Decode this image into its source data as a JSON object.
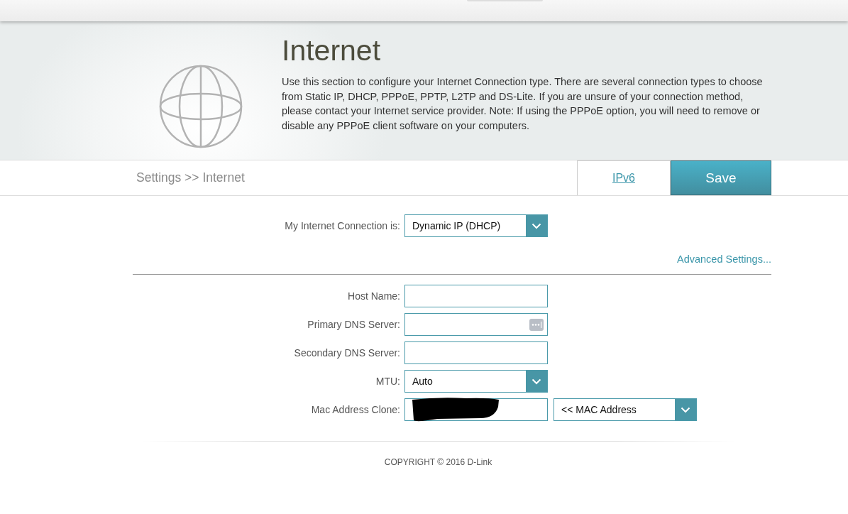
{
  "header": {
    "title": "Internet",
    "description": "Use this section to configure your Internet Connection type. There are several connection types to choose from Static IP, DHCP, PPPoE, PPTP, L2TP and DS-Lite. If you are unsure of your connection method, please contact your Internet service provider. Note: If using the PPPoE option, you will need to remove or disable any PPPoE client software on your computers."
  },
  "breadcrumb": "Settings >> Internet",
  "actions": {
    "link": "IPv6",
    "save": "Save"
  },
  "connection": {
    "label": "My Internet Connection is:",
    "value": "Dynamic IP (DHCP)"
  },
  "advanced_link": "Advanced Settings...",
  "fields": [
    {
      "kind": "text",
      "label": "Host Name:"
    },
    {
      "kind": "text",
      "label": "Primary DNS Server:",
      "autofill_icon": true
    },
    {
      "kind": "text",
      "label": "Secondary DNS Server:"
    },
    {
      "kind": "select",
      "label": "MTU:",
      "value": "Auto"
    },
    {
      "kind": "text",
      "label": "Mac Address Clone:",
      "redacted": true,
      "extra_select": "<< MAC Address"
    }
  ],
  "copyright": "COPYRIGHT © 2016 D-Link"
}
